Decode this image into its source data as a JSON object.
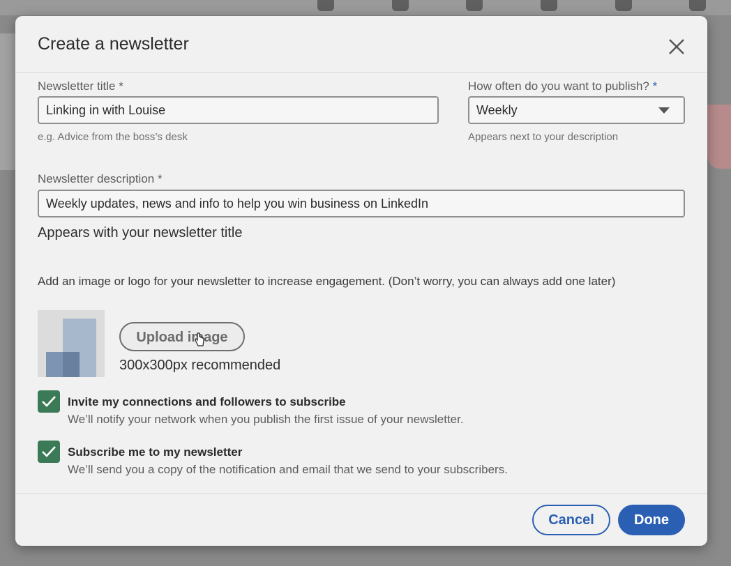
{
  "dialog": {
    "title": "Create a newsletter",
    "close_icon": "close-icon"
  },
  "form": {
    "title_label": "Newsletter title",
    "title_required": "*",
    "title_value": "Linking in with Louise",
    "title_hint": "e.g. Advice from the boss’s desk",
    "frequency_label": "How often do you want to publish?",
    "frequency_required": "*",
    "frequency_value": "Weekly",
    "frequency_hint": "Appears next to your description",
    "description_label": "Newsletter description",
    "description_required": "*",
    "description_value": "Weekly updates, news and info to help you win business on LinkedIn",
    "description_hint": "Appears with your newsletter title"
  },
  "image": {
    "prompt": "Add an image or logo for your newsletter to increase engagement. (Don’t worry, you can always add one later)",
    "upload_label": "Upload image",
    "recommendation": "300x300px recommended"
  },
  "options": [
    {
      "checked": true,
      "title": "Invite my connections and followers to subscribe",
      "subtitle": "We’ll notify your network when you publish the first issue of your newsletter."
    },
    {
      "checked": true,
      "title": "Subscribe me to my newsletter",
      "subtitle": "We’ll send you a copy of the notification and email that we send to your subscribers."
    }
  ],
  "footer": {
    "cancel_label": "Cancel",
    "done_label": "Done"
  },
  "colors": {
    "accent": "#2a5fb3",
    "checkbox": "#3b7a57",
    "dialog_bg": "#f1f1f1"
  }
}
